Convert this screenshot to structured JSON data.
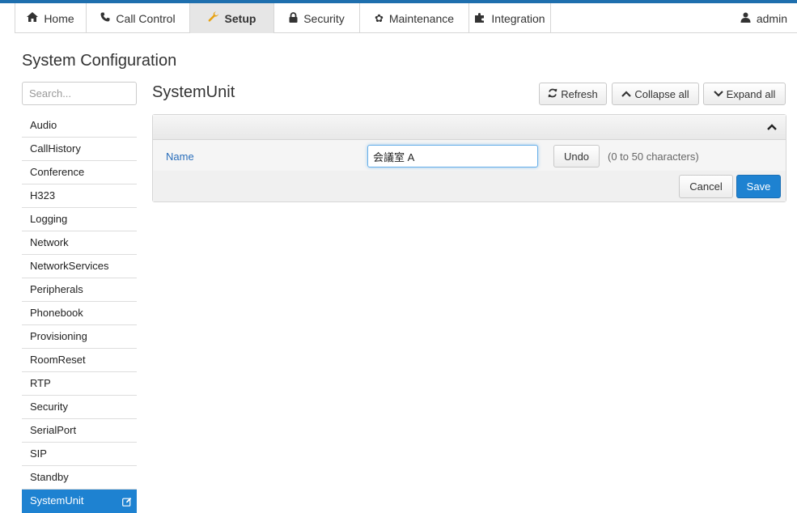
{
  "colors": {
    "accent": "#1e82d1",
    "link": "#2a6ebb",
    "topline": "#1e6fae"
  },
  "nav": {
    "tabs": [
      {
        "label": "Home",
        "icon": "home-icon"
      },
      {
        "label": "Call Control",
        "icon": "phone-icon"
      },
      {
        "label": "Setup",
        "icon": "wrench-icon",
        "active": true
      },
      {
        "label": "Security",
        "icon": "lock-icon"
      },
      {
        "label": "Maintenance",
        "icon": "gear-icon"
      },
      {
        "label": "Integration",
        "icon": "puzzle-icon"
      }
    ],
    "user": {
      "label": "admin",
      "icon": "user-icon"
    }
  },
  "page": {
    "title": "System Configuration"
  },
  "sidebar": {
    "search_placeholder": "Search...",
    "items": [
      {
        "label": "Audio"
      },
      {
        "label": "CallHistory"
      },
      {
        "label": "Conference"
      },
      {
        "label": "H323"
      },
      {
        "label": "Logging"
      },
      {
        "label": "Network"
      },
      {
        "label": "NetworkServices"
      },
      {
        "label": "Peripherals"
      },
      {
        "label": "Phonebook"
      },
      {
        "label": "Provisioning"
      },
      {
        "label": "RoomReset"
      },
      {
        "label": "RTP"
      },
      {
        "label": "Security"
      },
      {
        "label": "SerialPort"
      },
      {
        "label": "SIP"
      },
      {
        "label": "Standby"
      },
      {
        "label": "SystemUnit",
        "active": true
      }
    ]
  },
  "main": {
    "section_title": "SystemUnit",
    "toolbar": {
      "refresh_label": "Refresh",
      "collapse_label": "Collapse all",
      "expand_label": "Expand all"
    },
    "settings": {
      "name": {
        "label": "Name",
        "value": "会議室 A",
        "undo_label": "Undo",
        "hint": "(0 to 50 characters)"
      }
    },
    "actions": {
      "cancel_label": "Cancel",
      "save_label": "Save"
    }
  }
}
